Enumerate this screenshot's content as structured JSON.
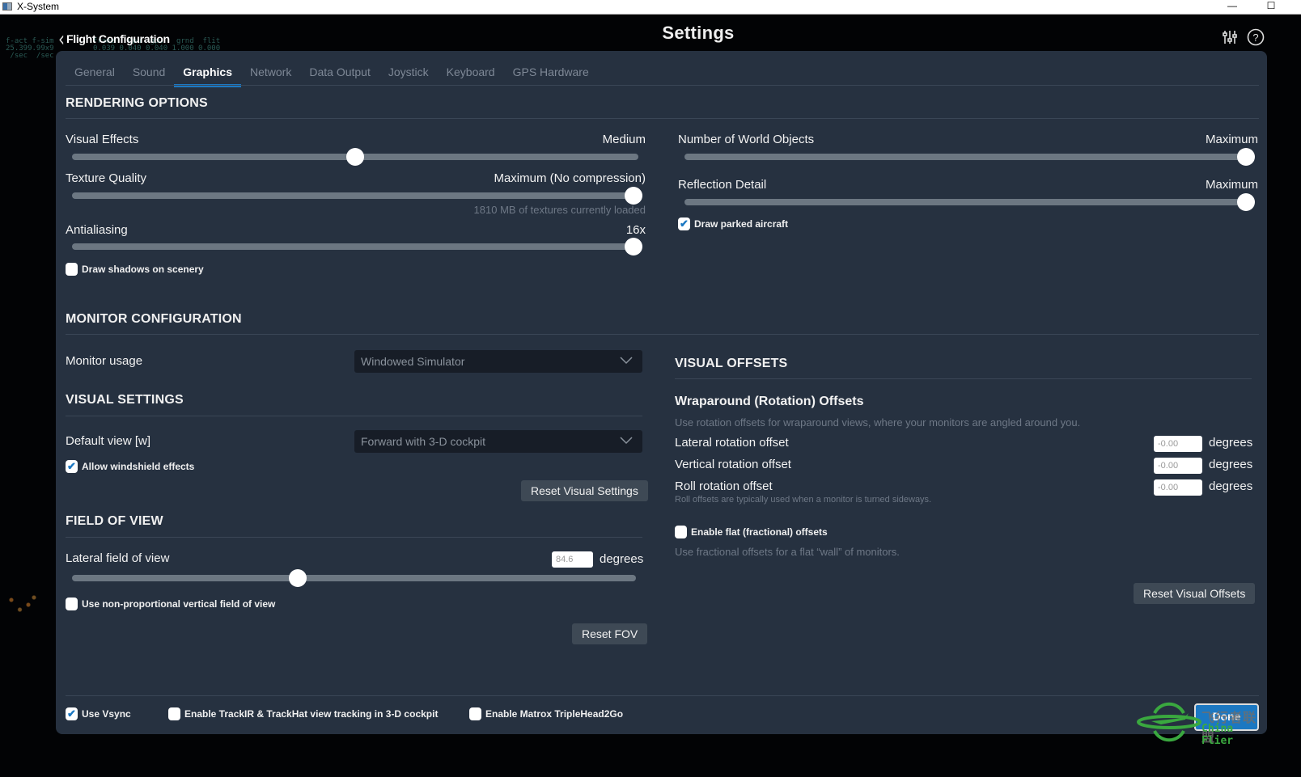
{
  "window": {
    "title": "X-System",
    "minimize_label": "—",
    "maximize_label": "☐"
  },
  "debug_overlay": {
    "left": "f-act f-sim\n25.399.99x9\n /sec  /sec",
    "right": "frame   cpu  gpu   grnd  flit\n0.039 0.040 0.040 1.000 0.000"
  },
  "header": {
    "back_label": "Flight Configuration",
    "title": "Settings",
    "icons": [
      "sliders-icon",
      "help-icon"
    ]
  },
  "tabs": [
    {
      "label": "General",
      "active": false
    },
    {
      "label": "Sound",
      "active": false
    },
    {
      "label": "Graphics",
      "active": true
    },
    {
      "label": "Network",
      "active": false
    },
    {
      "label": "Data Output",
      "active": false
    },
    {
      "label": "Joystick",
      "active": false
    },
    {
      "label": "Keyboard",
      "active": false
    },
    {
      "label": "GPS Hardware",
      "active": false
    }
  ],
  "rendering": {
    "title": "RENDERING OPTIONS",
    "visual_effects": {
      "label": "Visual Effects",
      "value": "Medium",
      "fraction": 0.5
    },
    "texture_quality": {
      "label": "Texture Quality",
      "value": "Maximum (No compression)",
      "fraction": 1.0,
      "note": "1810 MB of textures currently loaded"
    },
    "antialiasing": {
      "label": "Antialiasing",
      "value": "16x",
      "fraction": 1.0
    },
    "draw_shadows": {
      "label": "Draw shadows on scenery",
      "checked": false
    },
    "world_objects": {
      "label": "Number of World Objects",
      "value": "Maximum",
      "fraction": 1.0
    },
    "reflection_detail": {
      "label": "Reflection Detail",
      "value": "Maximum",
      "fraction": 1.0
    },
    "draw_parked_aircraft": {
      "label": "Draw parked aircraft",
      "checked": true
    }
  },
  "monitor": {
    "title": "MONITOR CONFIGURATION",
    "usage_label": "Monitor usage",
    "usage_value": "Windowed Simulator"
  },
  "visual_settings": {
    "title": "VISUAL SETTINGS",
    "default_view_label": "Default view [w]",
    "default_view_value": "Forward with 3-D cockpit",
    "windshield": {
      "label": "Allow windshield effects",
      "checked": true
    },
    "reset_label": "Reset Visual Settings"
  },
  "fov": {
    "title": "FIELD OF VIEW",
    "lateral_label": "Lateral field of view",
    "lateral_value": "84.6",
    "unit": "degrees",
    "fraction": 0.4,
    "non_proportional": {
      "label": "Use non-proportional vertical field of view",
      "checked": false
    },
    "reset_label": "Reset FOV"
  },
  "visual_offsets": {
    "title": "VISUAL OFFSETS",
    "wraparound_title": "Wraparound (Rotation) Offsets",
    "wraparound_hint": "Use rotation offsets for wraparound views, where your monitors are angled around you.",
    "rows": [
      {
        "label": "Lateral rotation offset",
        "value": "-0.00",
        "unit": "degrees"
      },
      {
        "label": "Vertical rotation offset",
        "value": "-0.00",
        "unit": "degrees"
      },
      {
        "label": "Roll rotation offset",
        "value": "-0.00",
        "unit": "degrees"
      }
    ],
    "roll_hint": "Roll offsets are typically used when a monitor is turned sideways.",
    "flat_offsets": {
      "label": "Enable flat (fractional) offsets",
      "checked": false
    },
    "flat_hint": "Use fractional offsets for a flat “wall” of monitors.",
    "reset_label": "Reset Visual Offsets"
  },
  "footer": {
    "vsync": {
      "label": "Use Vsync",
      "checked": true
    },
    "trackir": {
      "label": "Enable TrackIR & TrackHat view tracking in 3-D cockpit",
      "checked": false
    },
    "matrox": {
      "label": "Enable Matrox TripleHead2Go",
      "checked": false
    },
    "done_label": "Done"
  },
  "watermark": {
    "cn": "飞行者联盟",
    "en": "China Flier"
  },
  "colors": {
    "accent": "#1c78c2",
    "panel": "#263140",
    "watermark_green": "#3aa83f"
  }
}
